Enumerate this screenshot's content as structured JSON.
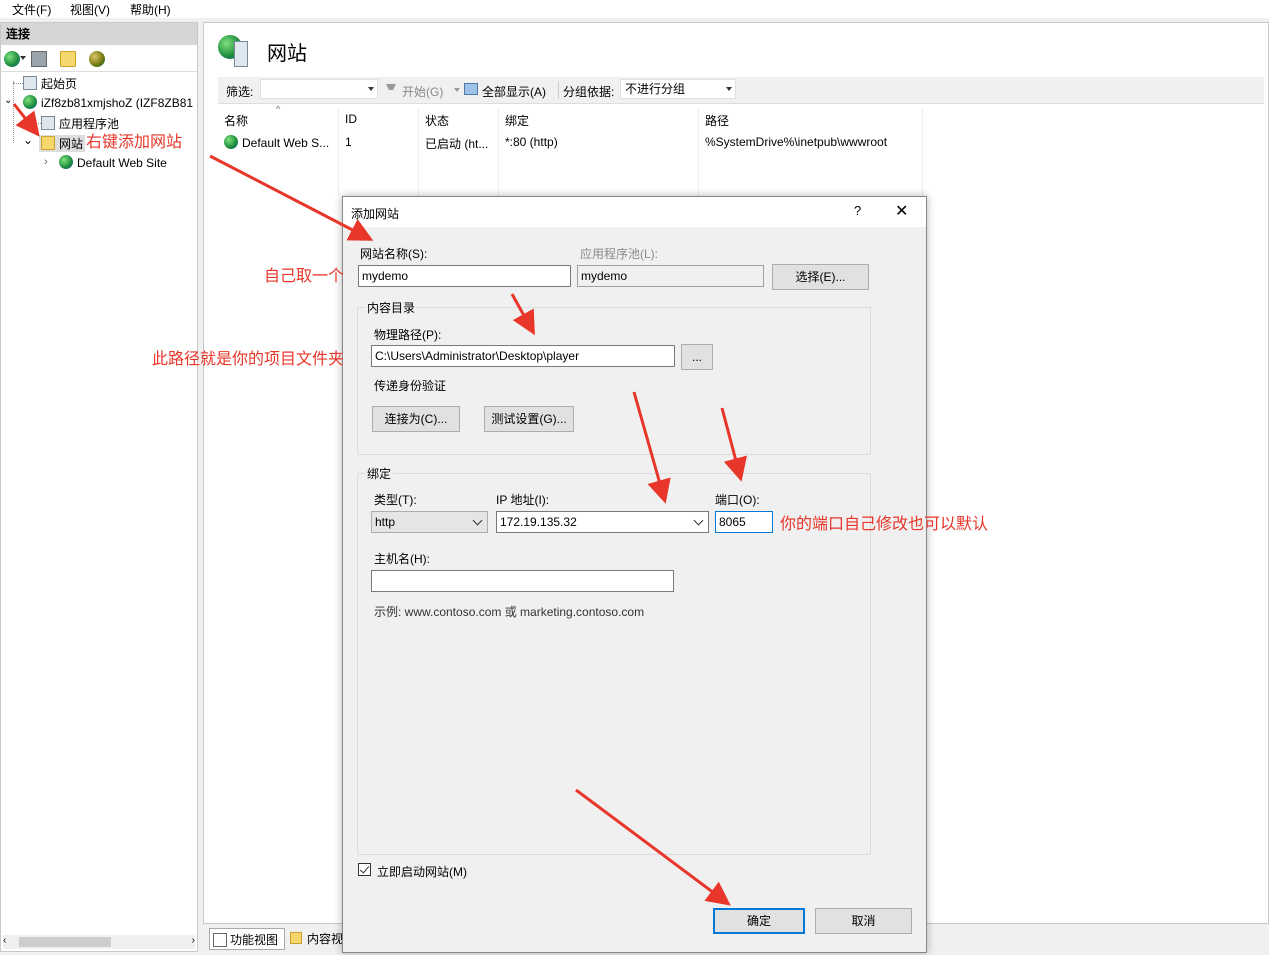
{
  "menu": {
    "file": "文件(F)",
    "view": "视图(V)",
    "help": "帮助(H)"
  },
  "connections": {
    "header": "连接",
    "tree": {
      "start_page": "起始页",
      "server": "iZf8zb81xmjshoZ (IZF8ZB81",
      "app_pools": "应用程序池",
      "sites": "网站",
      "default_site": "Default Web Site"
    }
  },
  "main": {
    "title": "网站",
    "filter_label": "筛选:",
    "start_label": "开始(G)",
    "show_all_label": "全部显示(A)",
    "group_by_label": "分组依据:",
    "group_by_value": "不进行分组",
    "columns": [
      "名称",
      "ID",
      "状态",
      "绑定",
      "路径"
    ],
    "rows": [
      {
        "name": "Default Web S...",
        "id": "1",
        "status": "已启动 (ht...",
        "binding": "*:80 (http)",
        "path": "%SystemDrive%\\inetpub\\wwwroot"
      }
    ],
    "tabs": {
      "features_view": "功能视图",
      "content_view": "内容视"
    }
  },
  "dialog": {
    "title": "添加网站",
    "help": "?",
    "close": "✕",
    "site_name_label": "网站名称(S):",
    "site_name_value": "mydemo",
    "app_pool_label": "应用程序池(L):",
    "app_pool_value": "mydemo",
    "select_button": "选择(E)...",
    "content_dir_title": "内容目录",
    "physical_path_label": "物理路径(P):",
    "physical_path_value": "C:\\Users\\Administrator\\Desktop\\player",
    "browse_button": "...",
    "pass_through_label": "传递身份验证",
    "connect_as_button": "连接为(C)...",
    "test_settings_button": "测试设置(G)...",
    "binding_title": "绑定",
    "type_label": "类型(T):",
    "type_value": "http",
    "ip_label": "IP 地址(I):",
    "ip_value": "172.19.135.32",
    "port_label": "端口(O):",
    "port_value": "8065",
    "host_label": "主机名(H):",
    "host_value": "",
    "example_text": "示例: www.contoso.com 或 marketing.contoso.com",
    "start_immediately_label": "立即启动网站(M)",
    "start_immediately_checked": true,
    "ok_button": "确定",
    "cancel_button": "取消"
  },
  "annotations": {
    "right_click": "右键添加网站",
    "name_yourself": "自己取一个",
    "path_note": "此路径就是你的项目文件夹",
    "port_note": "你的端口自己修改也可以默认"
  },
  "colors": {
    "annotation": "#e8362a",
    "accent": "#0078d7"
  }
}
